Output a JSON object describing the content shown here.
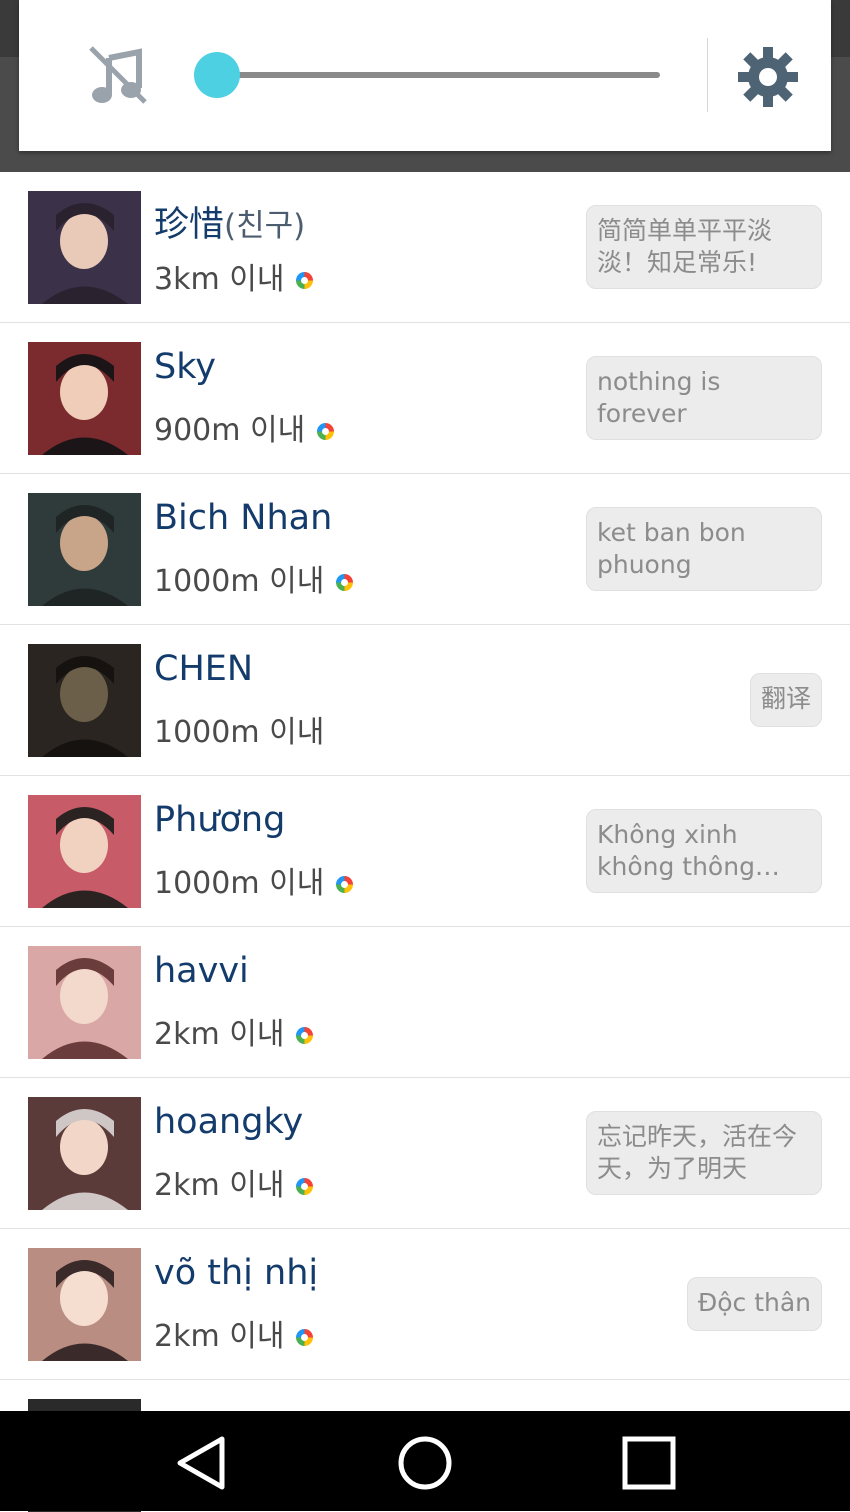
{
  "popup": {
    "music_icon": "music-off-icon",
    "volume_level": 0.0,
    "settings_icon": "gear-icon"
  },
  "users": [
    {
      "name": "珍惜",
      "name_suffix": "(친구)",
      "distance": "3km 이내",
      "online": true,
      "bubble": "简简单单平平淡淡！知足常乐!",
      "bubble_style": "wide",
      "avatar": "photo"
    },
    {
      "name": "Sky",
      "name_suffix": "",
      "distance": "900m 이내",
      "online": true,
      "bubble": "nothing is forever",
      "bubble_style": "wide",
      "avatar": "photo"
    },
    {
      "name": "Bich Nhan",
      "name_suffix": "",
      "distance": "1000m 이내",
      "online": true,
      "bubble": "ket ban bon phuong",
      "bubble_style": "wide",
      "avatar": "photo"
    },
    {
      "name": "CHEN",
      "name_suffix": "",
      "distance": "1000m 이내",
      "online": false,
      "bubble": "翻译",
      "bubble_style": "small",
      "avatar": "photo"
    },
    {
      "name": "Phương",
      "name_suffix": "",
      "distance": "1000m 이내",
      "online": true,
      "bubble": "Không xinh không thông…",
      "bubble_style": "wide",
      "avatar": "photo"
    },
    {
      "name": "havvi",
      "name_suffix": "",
      "distance": "2km 이내",
      "online": true,
      "bubble": "",
      "bubble_style": "none",
      "avatar": "photo"
    },
    {
      "name": "hoangky",
      "name_suffix": "",
      "distance": "2km 이내",
      "online": true,
      "bubble": "忘记昨天，活在今天，为了明天",
      "bubble_style": "wide",
      "avatar": "photo"
    },
    {
      "name": "võ thị nhị",
      "name_suffix": "",
      "distance": "2km 이내",
      "online": true,
      "bubble": "Độc thân",
      "bubble_style": "small",
      "avatar": "photo"
    }
  ],
  "colors": {
    "accent": "#4dd0e1",
    "name": "#133b6b",
    "bubble_bg": "#ececec"
  },
  "navbar": {
    "back_icon": "back-triangle-icon",
    "home_icon": "home-circle-icon",
    "recent_icon": "recent-square-icon"
  }
}
